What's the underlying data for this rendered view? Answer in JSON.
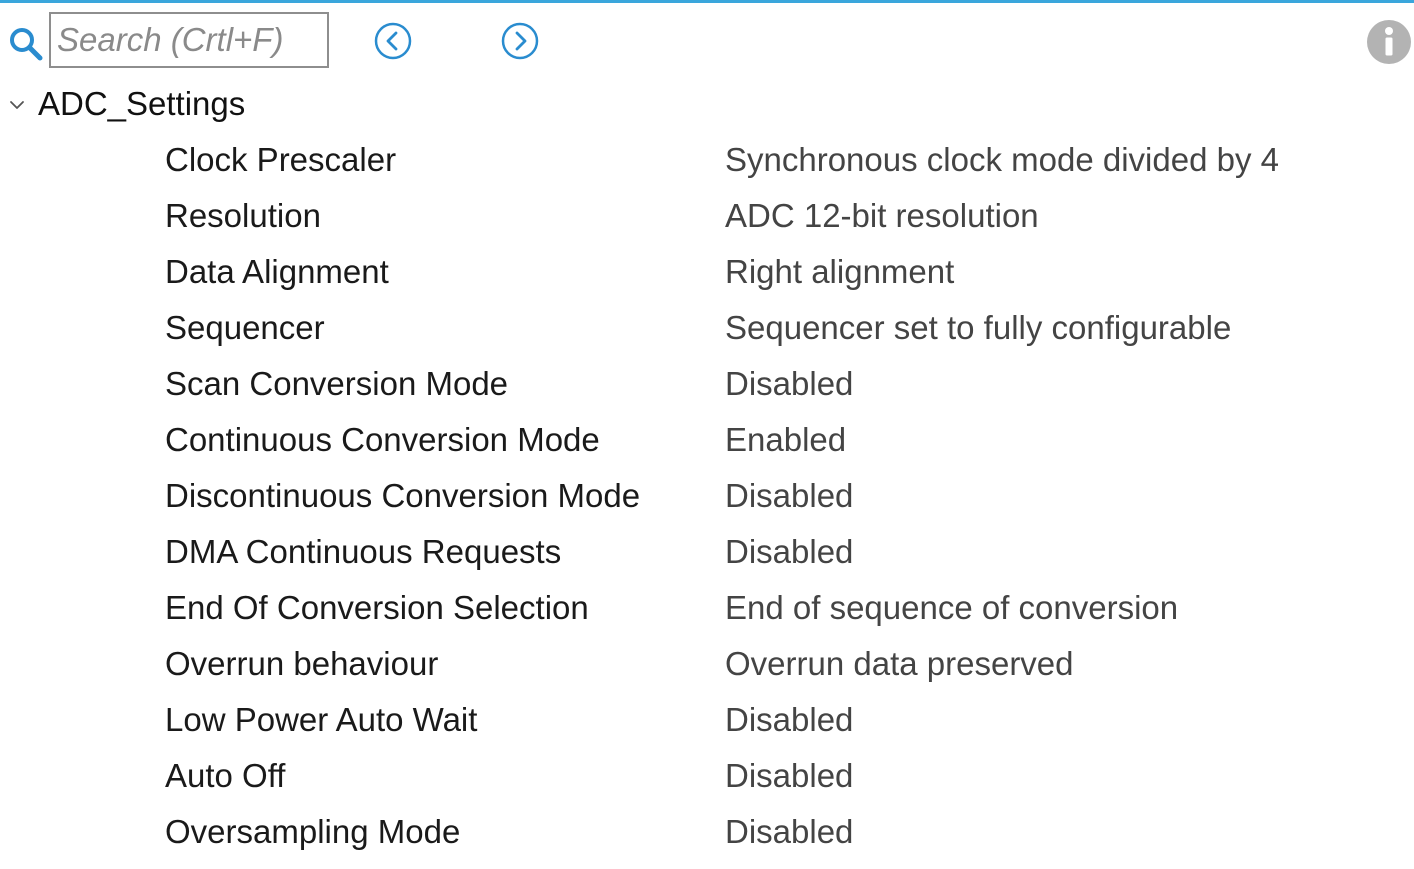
{
  "toolbar": {
    "search_icon": "search-icon",
    "search_placeholder": "Search (Crtl+F)",
    "search_value": "",
    "prev_icon": "chevron-left-circle-icon",
    "next_icon": "chevron-right-circle-icon",
    "info_icon": "info-icon"
  },
  "colors": {
    "accent": "#3aa6dc",
    "text": "#1a1a1a",
    "value_text": "#444444",
    "info_gray": "#b3b3b3"
  },
  "group": {
    "label": "ADC_Settings",
    "expanded": true,
    "settings": [
      {
        "name": "Clock Prescaler",
        "value": "Synchronous clock mode divided by 4"
      },
      {
        "name": "Resolution",
        "value": "ADC 12-bit resolution"
      },
      {
        "name": "Data Alignment",
        "value": "Right alignment"
      },
      {
        "name": "Sequencer",
        "value": "Sequencer set to fully configurable"
      },
      {
        "name": "Scan Conversion Mode",
        "value": "Disabled"
      },
      {
        "name": "Continuous Conversion Mode",
        "value": "Enabled"
      },
      {
        "name": "Discontinuous Conversion Mode",
        "value": "Disabled"
      },
      {
        "name": "DMA Continuous Requests",
        "value": "Disabled"
      },
      {
        "name": "End Of Conversion Selection",
        "value": "End of sequence of conversion"
      },
      {
        "name": "Overrun behaviour",
        "value": "Overrun data preserved"
      },
      {
        "name": "Low Power Auto Wait",
        "value": "Disabled"
      },
      {
        "name": "Auto Off",
        "value": "Disabled"
      },
      {
        "name": "Oversampling Mode",
        "value": "Disabled"
      }
    ]
  }
}
